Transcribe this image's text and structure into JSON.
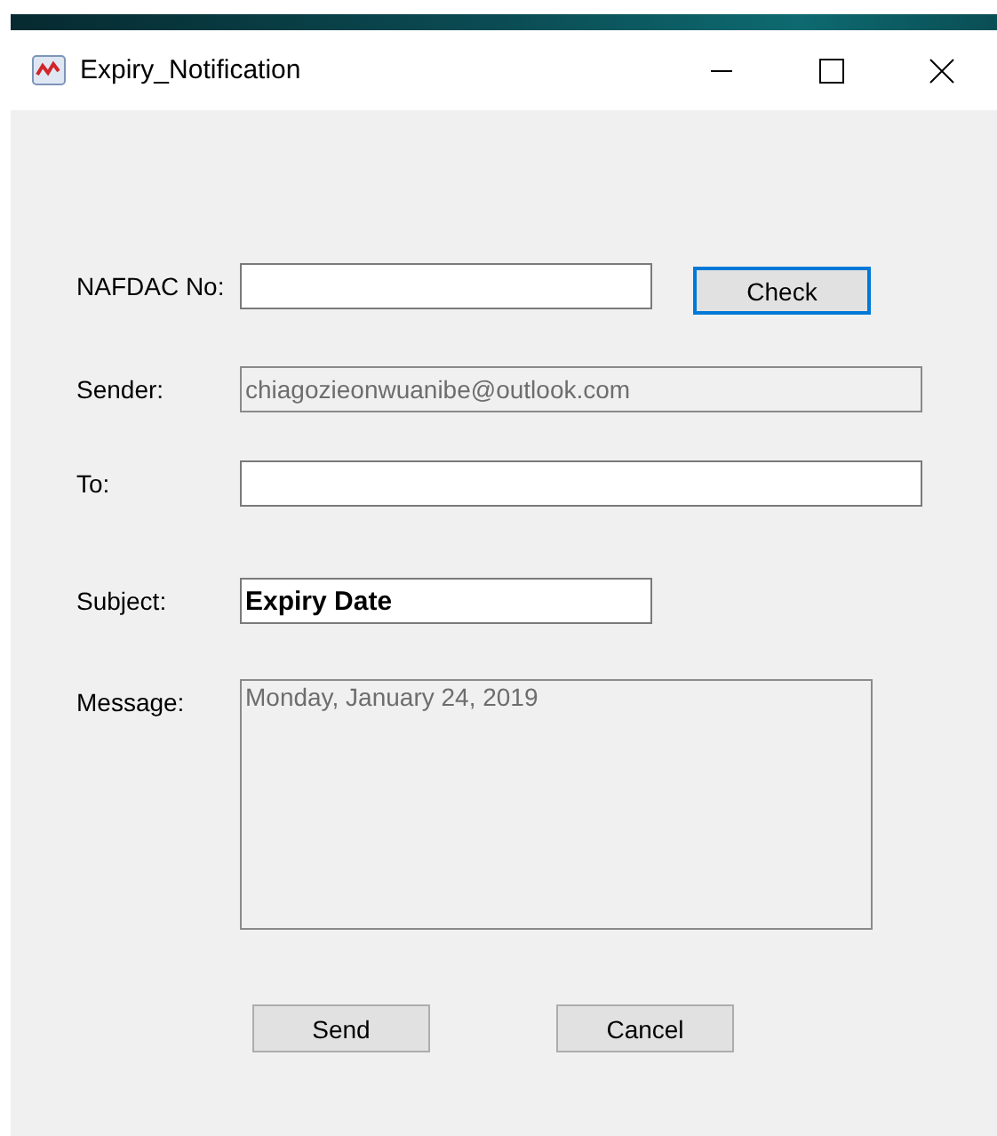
{
  "window": {
    "title": "Expiry_Notification"
  },
  "fields": [
    {
      "kind": "short",
      "label": "NAFDAC No:",
      "disabled": false
    },
    {
      "kind": "long",
      "label": "Sender:",
      "value": "chiagozieonwuanibe@outlook.com",
      "disabled": true,
      "bold": false
    },
    {
      "kind": "long",
      "label": "To:",
      "disabled": false
    },
    {
      "kind": "short",
      "label": "Subject:",
      "value": "Expiry Date",
      "disabled": false,
      "bold": true
    },
    {
      "kind": "textarea",
      "label": "Message:",
      "value": "Monday, January 24, 2019",
      "disabled": true,
      "bold": false
    }
  ],
  "check_button": {
    "label": "Check",
    "focused": true
  },
  "buttons": [
    {
      "label": "Send",
      "focused": false
    },
    {
      "label": "Cancel",
      "focused": false
    }
  ]
}
